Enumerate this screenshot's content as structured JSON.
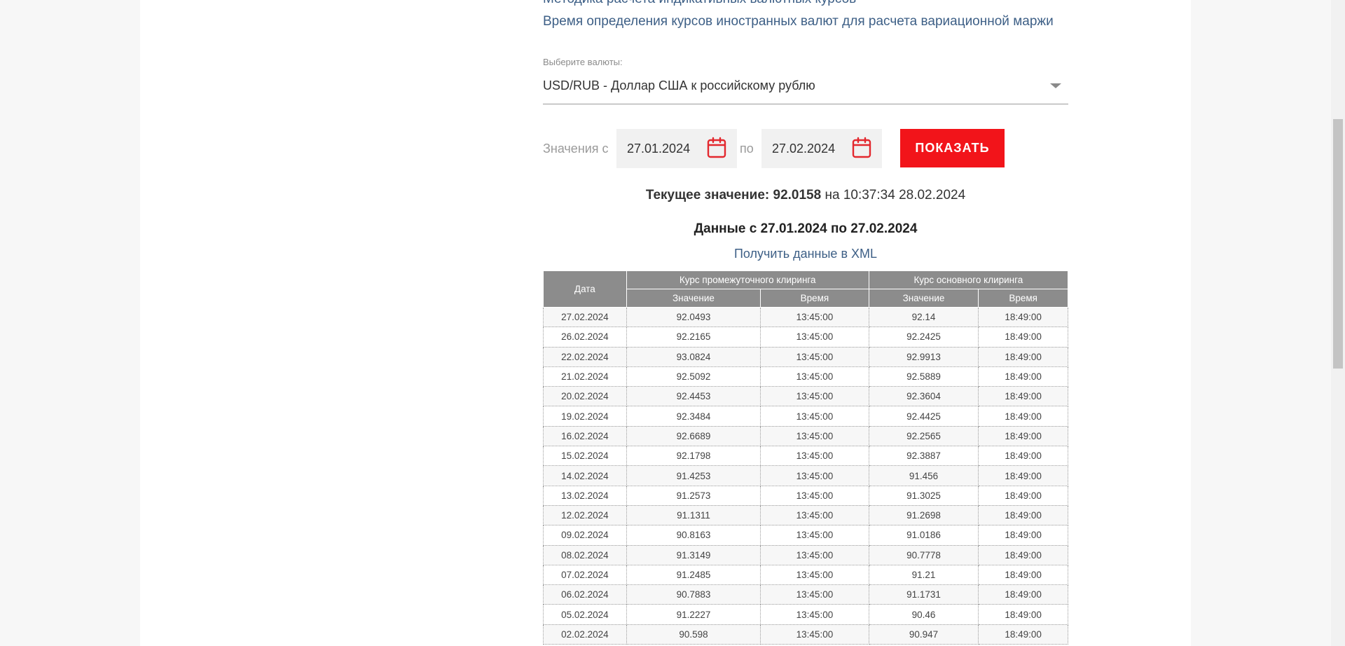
{
  "links": {
    "cut_link": "Методика расчета индикативных валютных курсов",
    "top_link": "Время определения курсов иностранных валют для расчета вариационной маржи"
  },
  "currency_select": {
    "label": "Выберите валюты:",
    "value": "USD/RUB - Доллар США к российскому рублю"
  },
  "date_range": {
    "from_label": "Значения с",
    "from_value": "27.01.2024",
    "to_label": "по",
    "to_value": "27.02.2024",
    "show_button": "ПОКАЗАТЬ",
    "calendar_icon": "calendar-icon"
  },
  "current": {
    "label": "Текущее значение:",
    "value": "92.0158",
    "on": "на",
    "timestamp": "10:37:34 28.02.2024"
  },
  "range_title": "Данные с 27.01.2024 по 27.02.2024",
  "xml_link": "Получить данные в XML",
  "table": {
    "header": {
      "date": "Дата",
      "interim_group": "Курс промежуточного клиринга",
      "main_group": "Курс основного клиринга",
      "value": "Значение",
      "time": "Время"
    },
    "rows": [
      [
        "27.02.2024",
        "92.0493",
        "13:45:00",
        "92.14",
        "18:49:00"
      ],
      [
        "26.02.2024",
        "92.2165",
        "13:45:00",
        "92.2425",
        "18:49:00"
      ],
      [
        "22.02.2024",
        "93.0824",
        "13:45:00",
        "92.9913",
        "18:49:00"
      ],
      [
        "21.02.2024",
        "92.5092",
        "13:45:00",
        "92.5889",
        "18:49:00"
      ],
      [
        "20.02.2024",
        "92.4453",
        "13:45:00",
        "92.3604",
        "18:49:00"
      ],
      [
        "19.02.2024",
        "92.3484",
        "13:45:00",
        "92.4425",
        "18:49:00"
      ],
      [
        "16.02.2024",
        "92.6689",
        "13:45:00",
        "92.2565",
        "18:49:00"
      ],
      [
        "15.02.2024",
        "92.1798",
        "13:45:00",
        "92.3887",
        "18:49:00"
      ],
      [
        "14.02.2024",
        "91.4253",
        "13:45:00",
        "91.456",
        "18:49:00"
      ],
      [
        "13.02.2024",
        "91.2573",
        "13:45:00",
        "91.3025",
        "18:49:00"
      ],
      [
        "12.02.2024",
        "91.1311",
        "13:45:00",
        "91.2698",
        "18:49:00"
      ],
      [
        "09.02.2024",
        "90.8163",
        "13:45:00",
        "91.0186",
        "18:49:00"
      ],
      [
        "08.02.2024",
        "91.3149",
        "13:45:00",
        "90.7778",
        "18:49:00"
      ],
      [
        "07.02.2024",
        "91.2485",
        "13:45:00",
        "91.21",
        "18:49:00"
      ],
      [
        "06.02.2024",
        "90.7883",
        "13:45:00",
        "91.1731",
        "18:49:00"
      ],
      [
        "05.02.2024",
        "91.2227",
        "13:45:00",
        "90.46",
        "18:49:00"
      ],
      [
        "02.02.2024",
        "90.598",
        "13:45:00",
        "90.947",
        "18:49:00"
      ]
    ]
  },
  "colors": {
    "accent_red": "#f2141a",
    "link_blue": "#3d5f86",
    "table_header": "#8c8c8c"
  }
}
